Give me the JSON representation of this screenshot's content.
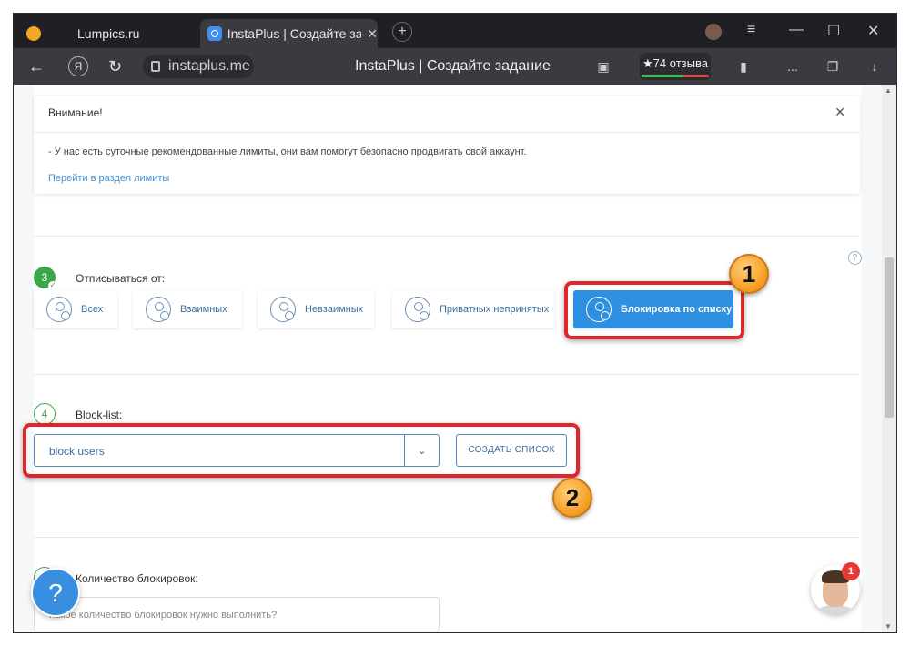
{
  "browser": {
    "tabs": [
      {
        "label": "Lumpics.ru"
      },
      {
        "label": "InstaPlus | Создайте задание",
        "close": "✕"
      }
    ],
    "new_tab": "+",
    "window_controls": {
      "menu": "≡",
      "minimize": "—",
      "maximize": "☐",
      "close": "✕"
    },
    "url": "instaplus.me",
    "page_title": "InstaPlus | Создайте задание",
    "rating": "★74 отзыва",
    "nav": {
      "back": "←",
      "yandex": "Я",
      "reload": "↻"
    },
    "toolbar_icons": {
      "bookmark": "▮",
      "more": "...",
      "download": "↓"
    }
  },
  "alert": {
    "title": "Внимание!",
    "close": "✕",
    "text": "- У нас есть суточные рекомендованные лимиты, они вам помогут безопасно продвигать свой аккаунт.",
    "link": "Перейти в раздел лимиты"
  },
  "step3": {
    "number": "3",
    "label": "Отписываться от:",
    "help": "?",
    "options": [
      {
        "label": "Всех",
        "active": false
      },
      {
        "label": "Взаимных",
        "active": false
      },
      {
        "label": "Невзаимных",
        "active": false
      },
      {
        "label": "Приватных непринятых",
        "active": false
      },
      {
        "label": "Блокировка по списку",
        "active": true
      }
    ]
  },
  "step4": {
    "number": "4",
    "label": "Block-list:",
    "select_value": "block users",
    "dropdown_icon": "⌄",
    "create_button": "СОЗДАТЬ СПИСОК"
  },
  "step5": {
    "number": "5",
    "label": "Количество блокировок:",
    "placeholder": "Какое количество блокировок нужно выполнить?"
  },
  "annotations": {
    "marker1": "1",
    "marker2": "2"
  },
  "help_fab": "?",
  "chat_badge": "1",
  "colors": {
    "accent": "#2f8fe0",
    "highlight": "#e0262b",
    "success": "#3aa84a",
    "marker": "#f59a1e"
  }
}
